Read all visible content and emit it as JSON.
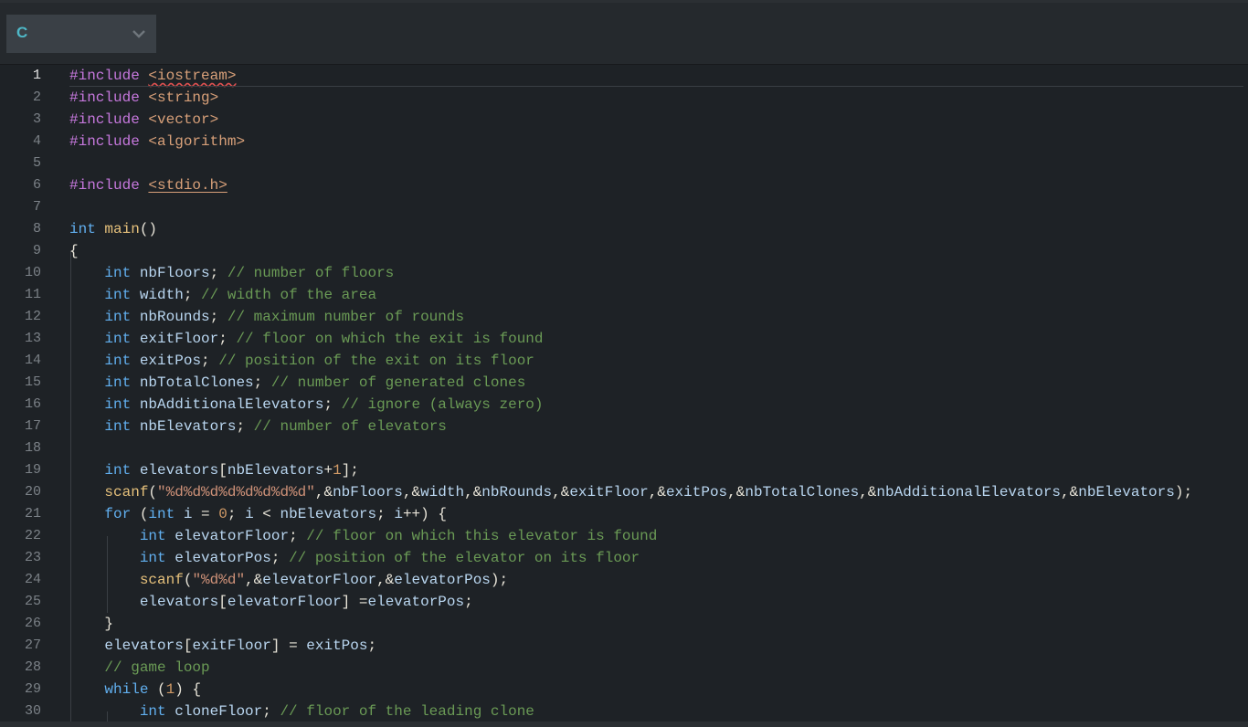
{
  "toolbar": {
    "language_select": {
      "value": "C",
      "chevron_icon": "chevron-down-icon"
    }
  },
  "theme": {
    "background": "#1e2226",
    "keyword": "#61afef",
    "preprocessor": "#c678dd",
    "include_path": "#d8a079",
    "function": "#e5c07b",
    "string": "#ce9178",
    "number": "#d19a66",
    "comment": "#6a9a55",
    "identifier": "#b9d6f0"
  },
  "editor": {
    "active_line": 1,
    "lines": [
      {
        "n": "1",
        "tokens": [
          [
            "pp",
            "#include"
          ],
          [
            "pu",
            " "
          ],
          [
            "inc",
            "<iostream>",
            "sq"
          ]
        ]
      },
      {
        "n": "2",
        "tokens": [
          [
            "pp",
            "#include"
          ],
          [
            "pu",
            " "
          ],
          [
            "inc",
            "<string>"
          ]
        ]
      },
      {
        "n": "3",
        "tokens": [
          [
            "pp",
            "#include"
          ],
          [
            "pu",
            " "
          ],
          [
            "inc",
            "<vector>"
          ]
        ]
      },
      {
        "n": "4",
        "tokens": [
          [
            "pp",
            "#include"
          ],
          [
            "pu",
            " "
          ],
          [
            "inc",
            "<algorithm>"
          ]
        ]
      },
      {
        "n": "5",
        "tokens": []
      },
      {
        "n": "6",
        "tokens": [
          [
            "pp",
            "#include"
          ],
          [
            "pu",
            " "
          ],
          [
            "inc",
            "<stdio.h>",
            "ul"
          ]
        ]
      },
      {
        "n": "7",
        "tokens": []
      },
      {
        "n": "8",
        "tokens": [
          [
            "kw",
            "int"
          ],
          [
            "pu",
            " "
          ],
          [
            "fn",
            "main"
          ],
          [
            "pu",
            "()"
          ]
        ]
      },
      {
        "n": "9",
        "tokens": [
          [
            "pu",
            "{"
          ]
        ]
      },
      {
        "n": "10",
        "tokens": [
          [
            "pu",
            "    "
          ],
          [
            "kw",
            "int"
          ],
          [
            "pu",
            " "
          ],
          [
            "var",
            "nbFloors"
          ],
          [
            "pu",
            "; "
          ],
          [
            "cm",
            "// number of floors"
          ]
        ]
      },
      {
        "n": "11",
        "tokens": [
          [
            "pu",
            "    "
          ],
          [
            "kw",
            "int"
          ],
          [
            "pu",
            " "
          ],
          [
            "var",
            "width"
          ],
          [
            "pu",
            "; "
          ],
          [
            "cm",
            "// width of the area"
          ]
        ]
      },
      {
        "n": "12",
        "tokens": [
          [
            "pu",
            "    "
          ],
          [
            "kw",
            "int"
          ],
          [
            "pu",
            " "
          ],
          [
            "var",
            "nbRounds"
          ],
          [
            "pu",
            "; "
          ],
          [
            "cm",
            "// maximum number of rounds"
          ]
        ]
      },
      {
        "n": "13",
        "tokens": [
          [
            "pu",
            "    "
          ],
          [
            "kw",
            "int"
          ],
          [
            "pu",
            " "
          ],
          [
            "var",
            "exitFloor"
          ],
          [
            "pu",
            "; "
          ],
          [
            "cm",
            "// floor on which the exit is found"
          ]
        ]
      },
      {
        "n": "14",
        "tokens": [
          [
            "pu",
            "    "
          ],
          [
            "kw",
            "int"
          ],
          [
            "pu",
            " "
          ],
          [
            "var",
            "exitPos"
          ],
          [
            "pu",
            "; "
          ],
          [
            "cm",
            "// position of the exit on its floor"
          ]
        ]
      },
      {
        "n": "15",
        "tokens": [
          [
            "pu",
            "    "
          ],
          [
            "kw",
            "int"
          ],
          [
            "pu",
            " "
          ],
          [
            "var",
            "nbTotalClones"
          ],
          [
            "pu",
            "; "
          ],
          [
            "cm",
            "// number of generated clones"
          ]
        ]
      },
      {
        "n": "16",
        "tokens": [
          [
            "pu",
            "    "
          ],
          [
            "kw",
            "int"
          ],
          [
            "pu",
            " "
          ],
          [
            "var",
            "nbAdditionalElevators"
          ],
          [
            "pu",
            "; "
          ],
          [
            "cm",
            "// ignore (always zero)"
          ]
        ]
      },
      {
        "n": "17",
        "tokens": [
          [
            "pu",
            "    "
          ],
          [
            "kw",
            "int"
          ],
          [
            "pu",
            " "
          ],
          [
            "var",
            "nbElevators"
          ],
          [
            "pu",
            "; "
          ],
          [
            "cm",
            "// number of elevators"
          ]
        ]
      },
      {
        "n": "18",
        "tokens": []
      },
      {
        "n": "19",
        "tokens": [
          [
            "pu",
            "    "
          ],
          [
            "kw",
            "int"
          ],
          [
            "pu",
            " "
          ],
          [
            "var",
            "elevators"
          ],
          [
            "pu",
            "["
          ],
          [
            "var",
            "nbElevators"
          ],
          [
            "pu",
            "+"
          ],
          [
            "num",
            "1"
          ],
          [
            "pu",
            "];"
          ]
        ]
      },
      {
        "n": "20",
        "tokens": [
          [
            "pu",
            "    "
          ],
          [
            "fn",
            "scanf"
          ],
          [
            "pu",
            "("
          ],
          [
            "str",
            "\"%d%d%d%d%d%d%d%d\""
          ],
          [
            "pu",
            ",&"
          ],
          [
            "var",
            "nbFloors"
          ],
          [
            "pu",
            ",&"
          ],
          [
            "var",
            "width"
          ],
          [
            "pu",
            ",&"
          ],
          [
            "var",
            "nbRounds"
          ],
          [
            "pu",
            ",&"
          ],
          [
            "var",
            "exitFloor"
          ],
          [
            "pu",
            ",&"
          ],
          [
            "var",
            "exitPos"
          ],
          [
            "pu",
            ",&"
          ],
          [
            "var",
            "nbTotalClones"
          ],
          [
            "pu",
            ",&"
          ],
          [
            "var",
            "nbAdditionalElevators"
          ],
          [
            "pu",
            ",&"
          ],
          [
            "var",
            "nbElevators"
          ],
          [
            "pu",
            ");"
          ]
        ]
      },
      {
        "n": "21",
        "tokens": [
          [
            "pu",
            "    "
          ],
          [
            "kw",
            "for"
          ],
          [
            "pu",
            " ("
          ],
          [
            "kw",
            "int"
          ],
          [
            "pu",
            " "
          ],
          [
            "var",
            "i"
          ],
          [
            "pu",
            " = "
          ],
          [
            "num",
            "0"
          ],
          [
            "pu",
            "; "
          ],
          [
            "var",
            "i"
          ],
          [
            "pu",
            " < "
          ],
          [
            "var",
            "nbElevators"
          ],
          [
            "pu",
            "; "
          ],
          [
            "var",
            "i"
          ],
          [
            "pu",
            "++) {"
          ]
        ]
      },
      {
        "n": "22",
        "tokens": [
          [
            "pu",
            "        "
          ],
          [
            "kw",
            "int"
          ],
          [
            "pu",
            " "
          ],
          [
            "var",
            "elevatorFloor"
          ],
          [
            "pu",
            "; "
          ],
          [
            "cm",
            "// floor on which this elevator is found"
          ]
        ]
      },
      {
        "n": "23",
        "tokens": [
          [
            "pu",
            "        "
          ],
          [
            "kw",
            "int"
          ],
          [
            "pu",
            " "
          ],
          [
            "var",
            "elevatorPos"
          ],
          [
            "pu",
            "; "
          ],
          [
            "cm",
            "// position of the elevator on its floor"
          ]
        ]
      },
      {
        "n": "24",
        "tokens": [
          [
            "pu",
            "        "
          ],
          [
            "fn",
            "scanf"
          ],
          [
            "pu",
            "("
          ],
          [
            "str",
            "\"%d%d\""
          ],
          [
            "pu",
            ",&"
          ],
          [
            "var",
            "elevatorFloor"
          ],
          [
            "pu",
            ",&"
          ],
          [
            "var",
            "elevatorPos"
          ],
          [
            "pu",
            ");"
          ]
        ]
      },
      {
        "n": "25",
        "tokens": [
          [
            "pu",
            "        "
          ],
          [
            "var",
            "elevators"
          ],
          [
            "pu",
            "["
          ],
          [
            "var",
            "elevatorFloor"
          ],
          [
            "pu",
            "] ="
          ],
          [
            "var",
            "elevatorPos"
          ],
          [
            "pu",
            ";"
          ]
        ]
      },
      {
        "n": "26",
        "tokens": [
          [
            "pu",
            "    }"
          ]
        ]
      },
      {
        "n": "27",
        "tokens": [
          [
            "pu",
            "    "
          ],
          [
            "var",
            "elevators"
          ],
          [
            "pu",
            "["
          ],
          [
            "var",
            "exitFloor"
          ],
          [
            "pu",
            "] = "
          ],
          [
            "var",
            "exitPos"
          ],
          [
            "pu",
            ";"
          ]
        ]
      },
      {
        "n": "28",
        "tokens": [
          [
            "pu",
            "    "
          ],
          [
            "cm",
            "// game loop"
          ]
        ]
      },
      {
        "n": "29",
        "tokens": [
          [
            "pu",
            "    "
          ],
          [
            "kw",
            "while"
          ],
          [
            "pu",
            " ("
          ],
          [
            "num",
            "1"
          ],
          [
            "pu",
            ") {"
          ]
        ]
      },
      {
        "n": "30",
        "tokens": [
          [
            "pu",
            "        "
          ],
          [
            "kw",
            "int"
          ],
          [
            "pu",
            " "
          ],
          [
            "var",
            "cloneFloor"
          ],
          [
            "pu",
            "; "
          ],
          [
            "cm",
            "// floor of the leading clone"
          ]
        ]
      }
    ]
  }
}
